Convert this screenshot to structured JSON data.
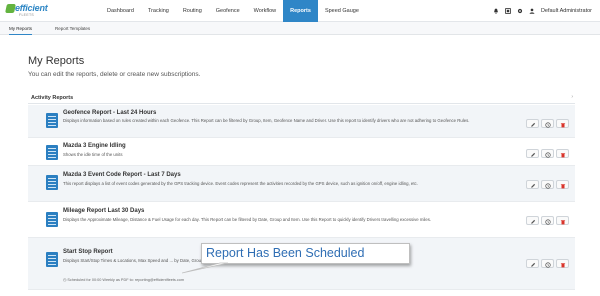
{
  "brand": {
    "name": "efficient",
    "tagline": "FLEETS",
    "logo_green": "#63b33f",
    "logo_blue": "#2d86c5"
  },
  "nav": {
    "items": [
      "Dashboard",
      "Tracking",
      "Routing",
      "Geofence",
      "Workflow",
      "Reports",
      "Speed Gauge"
    ],
    "active": "Reports",
    "accent": "#2f86c7"
  },
  "topbar": {
    "user_label": "Default Administrator",
    "icons": [
      "bell-icon",
      "grid-icon",
      "gear-icon",
      "user-icon"
    ]
  },
  "subnav": {
    "items": [
      "My Reports",
      "Report Templates"
    ],
    "active": "My Reports"
  },
  "page": {
    "title": "My Reports",
    "subtitle": "You can edit the reports, delete or create new subscriptions."
  },
  "panel": {
    "title": "Activity Reports",
    "reports": [
      {
        "title": "Geofence Report - Last 24 Hours",
        "description": "Displays information based on rules created within each Geofence. This Report can be filtered by Group, Item, Geofence Name and Driver. Use this report to identify drivers who are not adhering to Geofence Rules."
      },
      {
        "title": "Mazda 3 Engine Idling",
        "description": "Shows the idle time of the units"
      },
      {
        "title": "Mazda 3 Event Code Report - Last 7 Days",
        "description": "This report displays a list of event codes generated by the GPS tracking device. Event codes represent the activities recorded by the GPS device, such as ignition on/off, engine idling, etc."
      },
      {
        "title": "Mileage Report Last 30 Days",
        "description": "Displays the Approximate Mileage, Distance & Fuel Usage for each day. This Report can be filtered by Date, Group and Item. Use this Report to quickly identify Drivers travelling excessive miles."
      },
      {
        "title": "Start Stop Report",
        "description": "Displays Start/Stop Times & Locations, Max Speed and ... by Date, Groups and Item. Use this Report to quickly identify Stop Durations and Speeding.",
        "schedule": "Scheduled for 00:00 Weekly as PDF to: reporting@efficientfleets.com"
      }
    ]
  },
  "callout": {
    "text": "Report Has Been Scheduled",
    "color": "#2f6eb4"
  },
  "action_buttons": [
    "edit-icon",
    "clock-icon",
    "trash-icon"
  ],
  "colors": {
    "doc_icon": "#2b7fc1",
    "delete": "#d9342b",
    "row_alt": "#f2f5f8"
  }
}
